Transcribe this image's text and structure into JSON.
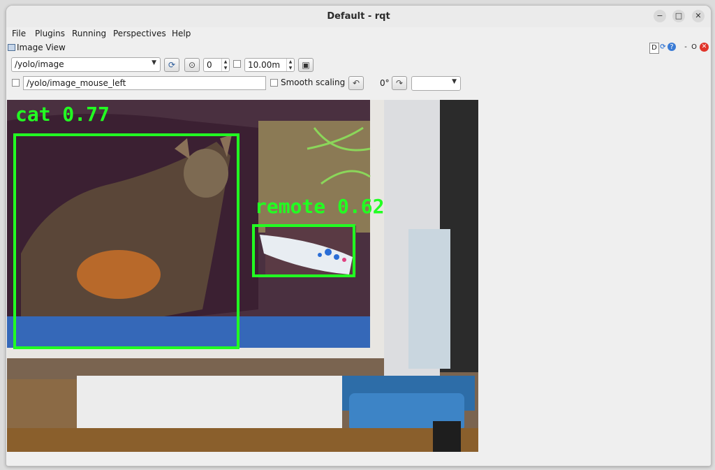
{
  "window": {
    "title": "Default - rqt"
  },
  "menubar": [
    "File",
    "Plugins",
    "Running",
    "Perspectives",
    "Help"
  ],
  "plugin": {
    "title": "Image View",
    "header_buttons": {
      "d": "D",
      "minus": "-",
      "o": "O"
    }
  },
  "toolbar": {
    "topic": "/yolo/image",
    "spin_value": "0",
    "duration": "10.00m",
    "mouse_topic": "/yolo/image_mouse_left",
    "smooth_scaling_label": "Smooth scaling",
    "rotation": "0°",
    "rotate_combo": ""
  },
  "image": {
    "detections": [
      {
        "label": "cat 0.77"
      },
      {
        "label": "remote 0.62"
      }
    ],
    "box_color": "#22ff22"
  }
}
